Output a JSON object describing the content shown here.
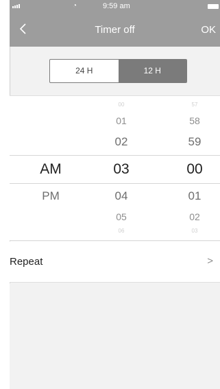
{
  "status": {
    "time": "9:59 am",
    "wifi_icon": "wifi-icon",
    "signal_icon": "signal-icon",
    "battery_icon": "battery-icon"
  },
  "nav": {
    "title": "Timer off",
    "ok_label": "OK",
    "back_icon": "chevron-left-icon"
  },
  "segment": {
    "options": [
      "24 H",
      "12 H"
    ],
    "selected": "12 H"
  },
  "picker": {
    "ampm": {
      "values": [
        "",
        "",
        "",
        "AM",
        "PM",
        "",
        ""
      ],
      "selected": "AM"
    },
    "hour": {
      "values": [
        "00",
        "01",
        "02",
        "03",
        "04",
        "05",
        "06"
      ],
      "selected": "03"
    },
    "minute": {
      "values": [
        "57",
        "58",
        "59",
        "00",
        "01",
        "02",
        "03"
      ],
      "selected": "00"
    }
  },
  "repeat": {
    "label": "Repeat",
    "chevron": ">"
  }
}
